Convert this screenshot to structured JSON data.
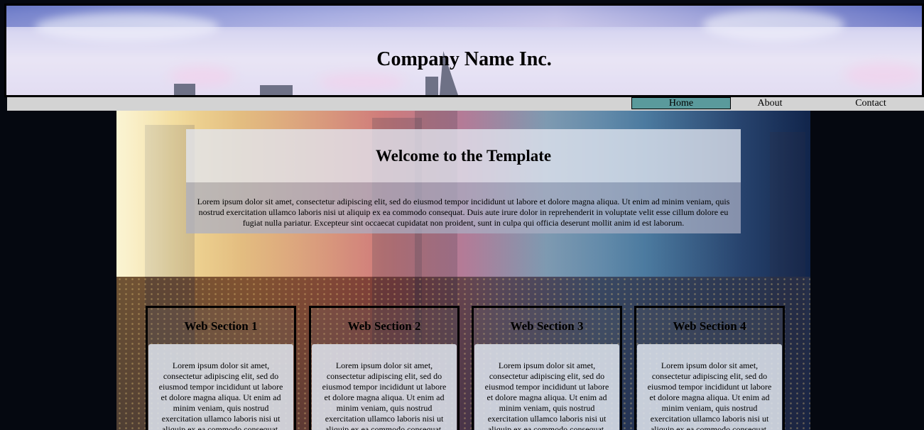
{
  "header": {
    "title": "Company Name Inc."
  },
  "nav": {
    "items": [
      {
        "label": "Home",
        "active": true
      },
      {
        "label": "About",
        "active": false
      },
      {
        "label": "Contact",
        "active": false
      }
    ],
    "active_color": "#5a9a9c",
    "bar_color": "#d3d3d3"
  },
  "welcome": {
    "title": "Welcome to the Template",
    "body": "Lorem ipsum dolor sit amet, consectetur adipiscing elit, sed do eiusmod tempor incididunt ut labore et dolore magna aliqua. Ut enim ad minim veniam, quis nostrud exercitation ullamco laboris nisi ut aliquip ex ea commodo consequat. Duis aute irure dolor in reprehenderit in voluptate velit esse cillum dolore eu fugiat nulla pariatur. Excepteur sint occaecat cupidatat non proident, sunt in culpa qui officia deserunt mollit anim id est laborum."
  },
  "sections": [
    {
      "title": "Web Section 1",
      "body": "Lorem ipsum dolor sit amet, consectetur adipiscing elit, sed do eiusmod tempor incididunt ut labore et dolore magna aliqua. Ut enim ad minim veniam, quis nostrud exercitation ullamco laboris nisi ut aliquip ex ea commodo consequat."
    },
    {
      "title": "Web Section 2",
      "body": "Lorem ipsum dolor sit amet, consectetur adipiscing elit, sed do eiusmod tempor incididunt ut labore et dolore magna aliqua. Ut enim ad minim veniam, quis nostrud exercitation ullamco laboris nisi ut aliquip ex ea commodo consequat."
    },
    {
      "title": "Web Section 3",
      "body": "Lorem ipsum dolor sit amet, consectetur adipiscing elit, sed do eiusmod tempor incididunt ut labore et dolore magna aliqua. Ut enim ad minim veniam, quis nostrud exercitation ullamco laboris nisi ut aliquip ex ea commodo consequat."
    },
    {
      "title": "Web Section 4",
      "body": "Lorem ipsum dolor sit amet, consectetur adipiscing elit, sed do eiusmod tempor incididunt ut labore et dolore magna aliqua. Ut enim ad minim veniam, quis nostrud exercitation ullamco laboris nisi ut aliquip ex ea commodo consequat."
    }
  ],
  "colors": {
    "page_background": "#050810",
    "border": "#000000"
  }
}
